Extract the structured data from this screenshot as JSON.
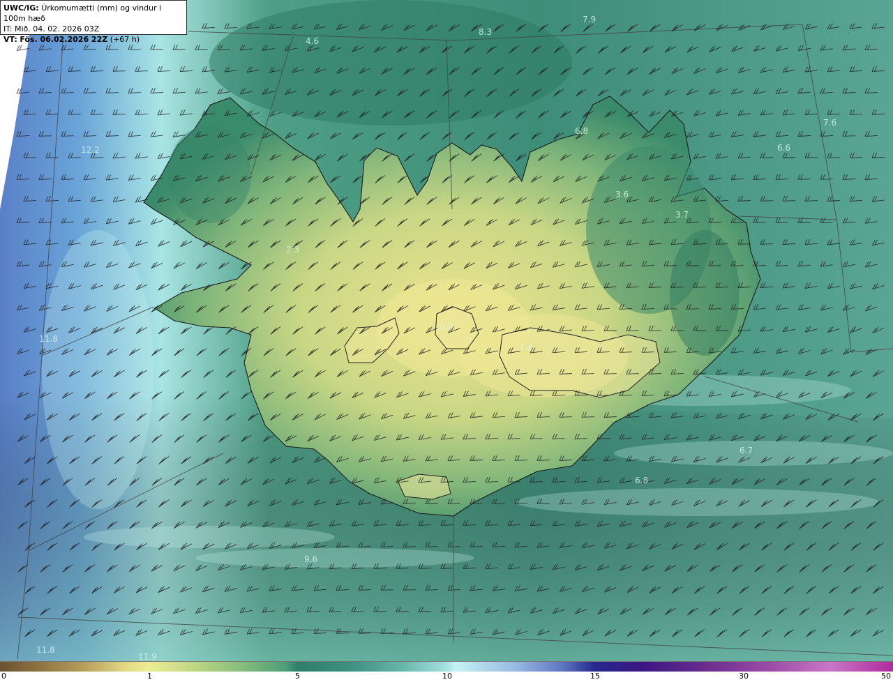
{
  "header": {
    "model": "UWC/IG:",
    "title": "Úrkomumætti (mm) og vindur i 100m hæð",
    "init_time": "IT: Mið. 04. 02. 2026 03Z",
    "valid_label": "VT:",
    "valid_time": "Fös. 06.02.2026 22Z",
    "lead_time": "(+67 h)"
  },
  "map": {
    "background_sea_color": "#3f8f7d",
    "land_low_color": "#e4dc8a",
    "land_mid_color": "#9cc47e",
    "land_high_color": "#2f7a62",
    "coastline_color": "#1a1a1a",
    "grid_line_color": "#444444",
    "wind_barb_color": "#2a2a2a"
  },
  "value_labels": [
    {
      "text": "7.9"
    },
    {
      "text": "8.3"
    },
    {
      "text": "4.6"
    },
    {
      "text": "12.2"
    },
    {
      "text": "7.6"
    },
    {
      "text": "6.6"
    },
    {
      "text": "6.8"
    },
    {
      "text": "3.6"
    },
    {
      "text": "3.7"
    },
    {
      "text": "2.3"
    },
    {
      "text": "0.9"
    },
    {
      "text": "1.4"
    },
    {
      "text": "11.8"
    },
    {
      "text": "9.6"
    },
    {
      "text": "6.8"
    },
    {
      "text": "6.7"
    },
    {
      "text": "11.8"
    },
    {
      "text": "11.9"
    }
  ],
  "colorbar": {
    "ticks": [
      "0",
      "1",
      "5",
      "10",
      "15",
      "30",
      "50"
    ]
  }
}
